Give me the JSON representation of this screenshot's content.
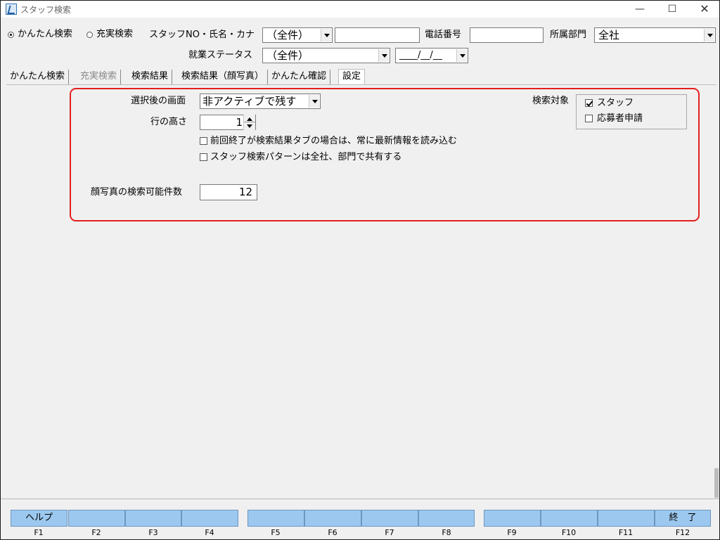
{
  "window": {
    "title": "スタッフ検索",
    "minimize": "—",
    "maximize": "☐",
    "close": "✕"
  },
  "search": {
    "mode_easy": "かんたん検索",
    "mode_full": "充実検索",
    "staff_label": "スタッフNO・氏名・カナ",
    "staff_select": "（全件）",
    "staff_value": "",
    "phone_label": "電話番号",
    "phone_value": "",
    "dept_label": "所属部門",
    "dept_value": "全社",
    "status_label": "就業ステータス",
    "status_value": "（全件）",
    "date_value": "____/__/__"
  },
  "tabs": [
    {
      "label": "かんたん検索"
    },
    {
      "label": "充実検索"
    },
    {
      "label": "検索結果"
    },
    {
      "label": "検索結果（顔写真）"
    },
    {
      "label": "かんたん確認"
    },
    {
      "label": "設定"
    }
  ],
  "settings": {
    "after_select_label": "選択後の画面",
    "after_select_value": "非アクティブで残す",
    "row_height_label": "行の高さ",
    "row_height_value": "1",
    "option1": "前回終了が検索結果タブの場合は、常に最新情報を読み込む",
    "option2": "スタッフ検索パターンは全社、部門で共有する",
    "photo_count_label": "顔写真の検索可能件数",
    "photo_count_value": "12",
    "target_label": "検索対象",
    "target_staff": "スタッフ",
    "target_applicant": "応募者申請"
  },
  "fkeys": [
    {
      "label": "ヘルプ",
      "key": "F1"
    },
    {
      "label": "",
      "key": "F2"
    },
    {
      "label": "",
      "key": "F3"
    },
    {
      "label": "",
      "key": "F4"
    },
    {
      "label": "",
      "key": "F5"
    },
    {
      "label": "",
      "key": "F6"
    },
    {
      "label": "",
      "key": "F7"
    },
    {
      "label": "",
      "key": "F8"
    },
    {
      "label": "",
      "key": "F9"
    },
    {
      "label": "",
      "key": "F10"
    },
    {
      "label": "",
      "key": "F11"
    },
    {
      "label": "終　了",
      "key": "F12"
    }
  ]
}
